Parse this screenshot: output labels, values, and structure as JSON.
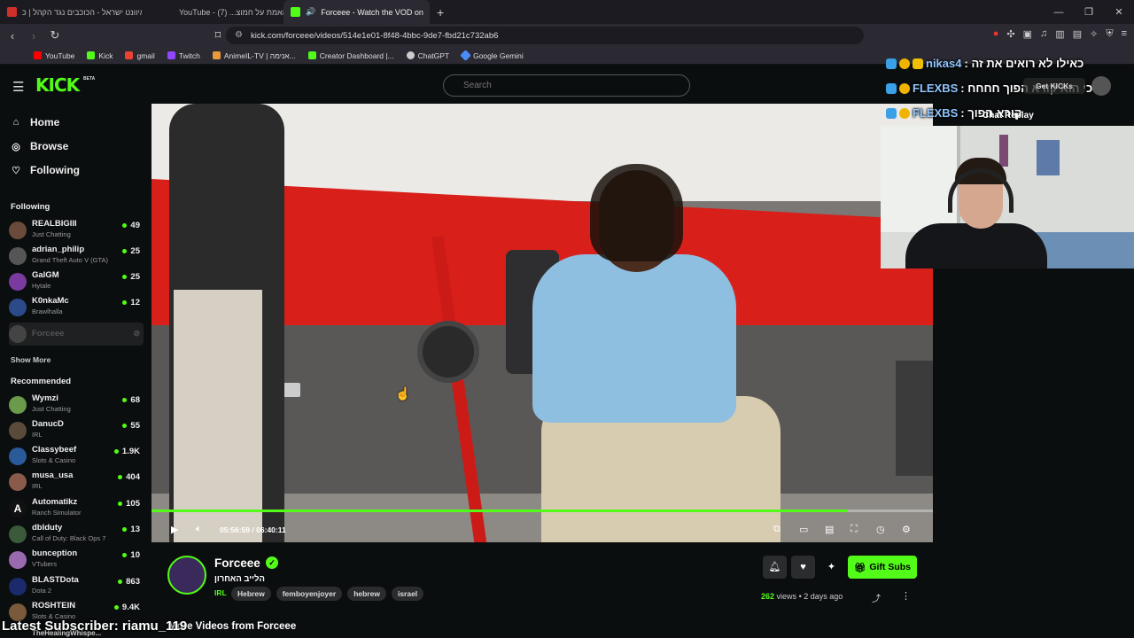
{
  "browser": {
    "tabs": [
      {
        "title": "איוונט ישראל - הכוכבים נגד הקהל | כ",
        "favicon_color": "#53fc18"
      },
      {
        "title": "YouTube - האמת על חמוצ... (7)",
        "favicon_color": "#ff0000"
      },
      {
        "title": "Forceee - Watch the VOD on",
        "favicon_color": "#53fc18"
      }
    ],
    "new_tab_label": "+",
    "url": "kick.com/forceee/videos/514e1e01-8f48-4bbc-9de7-fbd21c732ab6",
    "bookmarks": [
      {
        "label": "YouTube",
        "color": "#ff0000"
      },
      {
        "label": "Kick",
        "color": "#53fc18"
      },
      {
        "label": "gmail",
        "color": "#ea4335"
      },
      {
        "label": "Twitch",
        "color": "#9146ff"
      },
      {
        "label": "AnimeIL-TV | אנימה...",
        "color": "#e89a3c"
      },
      {
        "label": "Creator Dashboard |...",
        "color": "#53fc18"
      },
      {
        "label": "ChatGPT",
        "color": "#cccccc"
      },
      {
        "label": "Google Gemini",
        "color": "#4a8cf7"
      }
    ]
  },
  "header": {
    "logo": "KICK",
    "beta": "BETA",
    "search_placeholder": "Search"
  },
  "sidebar": {
    "nav": [
      {
        "label": "Home",
        "icon": "home-icon"
      },
      {
        "label": "Browse",
        "icon": "compass-icon"
      },
      {
        "label": "Following",
        "icon": "heart-icon"
      }
    ],
    "following_heading": "Following",
    "following": [
      {
        "name": "REALBIGIII",
        "game": "Just Chatting",
        "viewers": "49",
        "color": "#6a4a3a"
      },
      {
        "name": "adrian_philip",
        "game": "Grand Theft Auto V (GTA)",
        "viewers": "25",
        "color": "#555555"
      },
      {
        "name": "GalGM",
        "game": "Hytale",
        "viewers": "25",
        "color": "#7a3aa0"
      },
      {
        "name": "K0nkaMc",
        "game": "Brawlhalla",
        "viewers": "12",
        "color": "#2a4a8a"
      },
      {
        "name": "Forceee",
        "game": "",
        "viewers": "",
        "color": "#444444"
      }
    ],
    "show_more": "Show More",
    "recommended_heading": "Recommended",
    "recommended": [
      {
        "name": "Wymzi",
        "game": "Just Chatting",
        "viewers": "68",
        "color": "#6a9a4a"
      },
      {
        "name": "DanucD",
        "game": "IRL",
        "viewers": "55",
        "color": "#5a4a3a"
      },
      {
        "name": "Classybeef",
        "game": "Slots & Casino",
        "viewers": "1.9K",
        "color": "#2a5a9a"
      },
      {
        "name": "musa_usa",
        "game": "IRL",
        "viewers": "404",
        "color": "#8a5a4a"
      },
      {
        "name": "Automatikz",
        "game": "Ranch Simulator",
        "viewers": "105",
        "color": "#111111"
      },
      {
        "name": "dblduty",
        "game": "Call of Duty: Black Ops 7",
        "viewers": "13",
        "color": "#3a5a3a"
      },
      {
        "name": "bunception",
        "game": "VTubers",
        "viewers": "10",
        "color": "#9a6ab0"
      },
      {
        "name": "BLASTDota",
        "game": "Dota 2",
        "viewers": "863",
        "color": "#1a2a6a"
      },
      {
        "name": "ROSHTEIN",
        "game": "Slots & Casino",
        "viewers": "9.4K",
        "color": "#7a5a3a"
      }
    ],
    "cutoff_item": "TheHealingWhispe..."
  },
  "player": {
    "current_time": "05:56:59",
    "duration": "06:40:11",
    "time_separator": "/",
    "progress_fraction": 0.89
  },
  "overlay": {
    "chat": [
      {
        "user": "nikas4",
        "message": ": כאילו לא רואים את זה"
      },
      {
        "user": "FLEXBS",
        "message": ": כי הוא קורא הפוך חחחח"
      },
      {
        "user": "FLEXBS",
        "message": ": קורא הפוך"
      }
    ],
    "chat_replay": "Chat Replay",
    "get_kick": "Get KICKs",
    "latest_sub": "Latest Subscriber: riamu_119"
  },
  "channel": {
    "name": "Forceee",
    "title": "הלייב האחרון",
    "category": "IRL",
    "tags": [
      "Hebrew",
      "femboyenjoyer",
      "hebrew",
      "israel"
    ],
    "gift_label": "Gift Subs",
    "views": "262",
    "views_label": "views",
    "age": "2 days ago",
    "more_videos": "More Videos from Forceee"
  }
}
